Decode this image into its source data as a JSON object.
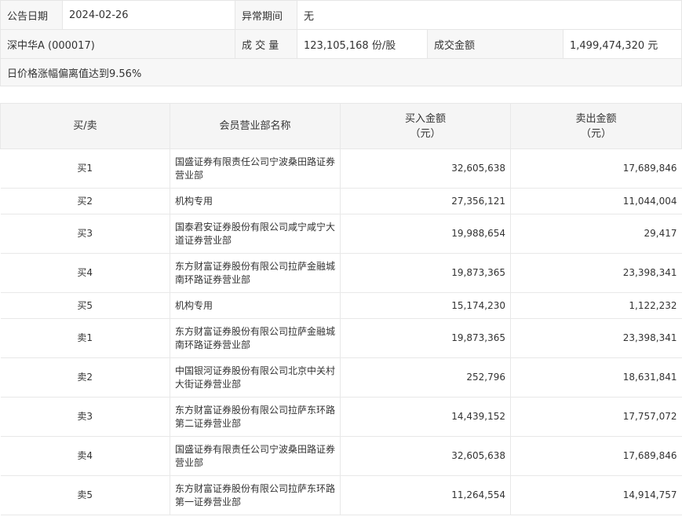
{
  "info": {
    "date_label": "公告日期",
    "date_value": "2024-02-26",
    "abnormal_label": "异常期间",
    "abnormal_value": "无",
    "stock": "深中华A (000017)",
    "volume_label": "成 交 量",
    "volume_value": "123,105,168 份/股",
    "amount_label": "成交金额",
    "amount_value": "1,499,474,320 元",
    "reason": "日价格涨幅偏离值达到9.56%"
  },
  "table": {
    "headers": {
      "side": "买/卖",
      "broker": "会员营业部名称",
      "buy_line1": "买入金额",
      "buy_line2": "（元）",
      "sell_line1": "卖出金额",
      "sell_line2": "（元）"
    },
    "rows": [
      {
        "side": "买1",
        "broker": "国盛证券有限责任公司宁波桑田路证券营业部",
        "buy": "32,605,638",
        "sell": "17,689,846"
      },
      {
        "side": "买2",
        "broker": "机构专用",
        "buy": "27,356,121",
        "sell": "11,044,004"
      },
      {
        "side": "买3",
        "broker": "国泰君安证券股份有限公司咸宁咸宁大道证券营业部",
        "buy": "19,988,654",
        "sell": "29,417"
      },
      {
        "side": "买4",
        "broker": "东方财富证券股份有限公司拉萨金融城南环路证券营业部",
        "buy": "19,873,365",
        "sell": "23,398,341"
      },
      {
        "side": "买5",
        "broker": "机构专用",
        "buy": "15,174,230",
        "sell": "1,122,232"
      },
      {
        "side": "卖1",
        "broker": "东方财富证券股份有限公司拉萨金融城南环路证券营业部",
        "buy": "19,873,365",
        "sell": "23,398,341"
      },
      {
        "side": "卖2",
        "broker": "中国银河证券股份有限公司北京中关村大街证券营业部",
        "buy": "252,796",
        "sell": "18,631,841"
      },
      {
        "side": "卖3",
        "broker": "东方财富证券股份有限公司拉萨东环路第二证券营业部",
        "buy": "14,439,152",
        "sell": "17,757,072"
      },
      {
        "side": "卖4",
        "broker": "国盛证券有限责任公司宁波桑田路证券营业部",
        "buy": "32,605,638",
        "sell": "17,689,846"
      },
      {
        "side": "卖5",
        "broker": "东方财富证券股份有限公司拉萨东环路第一证券营业部",
        "buy": "11,264,554",
        "sell": "14,914,757"
      }
    ]
  }
}
